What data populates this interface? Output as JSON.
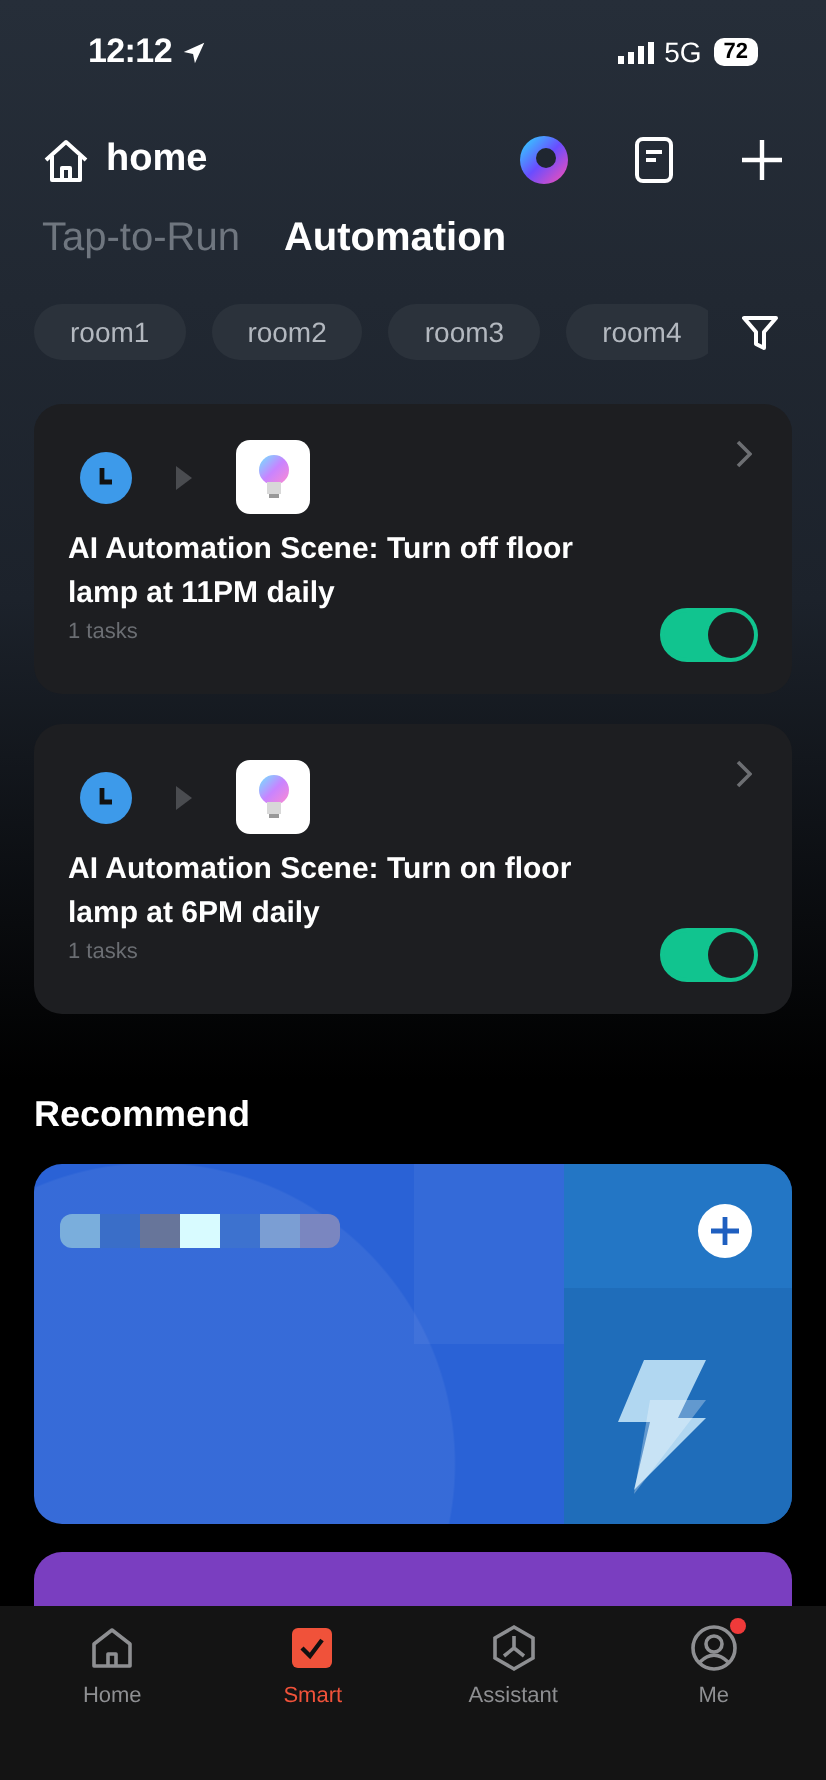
{
  "status_bar": {
    "time": "12:12",
    "network": "5G",
    "battery": "72"
  },
  "header": {
    "title": "home"
  },
  "tabs": [
    {
      "label": "Tap-to-Run",
      "selected": false
    },
    {
      "label": "Automation",
      "selected": true
    }
  ],
  "rooms": [
    "room1",
    "room2",
    "room3",
    "room4"
  ],
  "automations": [
    {
      "title": "AI Automation Scene: Turn off floor lamp at 11PM daily",
      "tasks": "1 tasks",
      "enabled": true
    },
    {
      "title": "AI Automation Scene: Turn on floor lamp at 6PM daily",
      "tasks": "1 tasks",
      "enabled": true
    }
  ],
  "recommend": {
    "title": "Recommend",
    "cards": [
      {
        "kind": "pixelated",
        "color": "#2a62d6"
      },
      {
        "kind": "plain",
        "color": "#7a3ec0"
      }
    ]
  },
  "nav": [
    {
      "label": "Home",
      "selected": false,
      "badge": false
    },
    {
      "label": "Smart",
      "selected": true,
      "badge": false
    },
    {
      "label": "Assistant",
      "selected": false,
      "badge": false
    },
    {
      "label": "Me",
      "selected": false,
      "badge": true
    }
  ]
}
